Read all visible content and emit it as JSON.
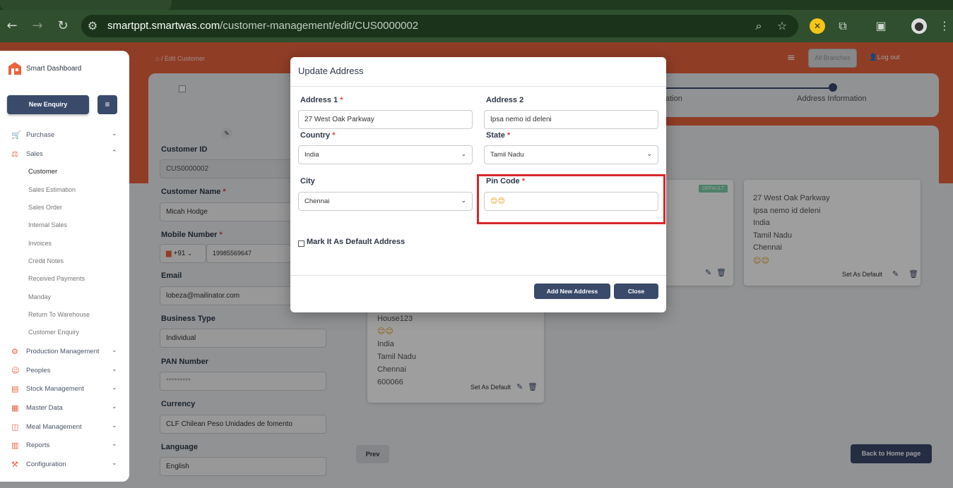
{
  "browser": {
    "url_host": "smartppt.smartwas.com",
    "url_path": "/customer-management/edit/CUS0000002"
  },
  "sidebar": {
    "brand": "Smart Dashboard",
    "new_enquiry": "New Enquiry",
    "items": [
      {
        "label": "Purchase",
        "icon": "cart-icon"
      },
      {
        "label": "Sales",
        "icon": "sales-icon"
      },
      {
        "label": "Production Management",
        "icon": "factory-icon"
      },
      {
        "label": "Peoples",
        "icon": "people-icon"
      },
      {
        "label": "Stock Management",
        "icon": "stock-icon"
      },
      {
        "label": "Master Data",
        "icon": "grid-icon"
      },
      {
        "label": "Meal Management",
        "icon": "meal-icon"
      },
      {
        "label": "Reports",
        "icon": "report-icon"
      },
      {
        "label": "Configuration",
        "icon": "config-icon"
      }
    ],
    "sales_sub": [
      "Customer",
      "Sales Estimation",
      "Sales Order",
      "Internal Sales",
      "Invoices",
      "Credit Notes",
      "Received Payments",
      "Manday",
      "Return To Warehouse",
      "Customer Enquiry"
    ]
  },
  "header": {
    "breadcrumb": "Edit Customer",
    "branch": "All Branches",
    "logout": "Log out"
  },
  "steps": {
    "step_partial": "ation",
    "step_last": "Address Information"
  },
  "form": {
    "customer_id_label": "Customer ID",
    "customer_id": "CUS0000002",
    "customer_name_label": "Customer Name",
    "customer_name": "Micah Hodge",
    "mobile_label": "Mobile Number",
    "country_code": "+91",
    "mobile": "19985569647",
    "email_label": "Email",
    "email": "lobeza@mailinator.com",
    "business_type_label": "Business Type",
    "business_type": "Individual",
    "pan_label": "PAN Number",
    "pan": "*********",
    "currency_label": "Currency",
    "currency": "CLF Chilean Peso Unidades de fomento",
    "language_label": "Language",
    "language": "English"
  },
  "address_cards": [
    {
      "lines": [
        "House123",
        "😊😊",
        "India",
        "Tamil Nadu",
        "Chennai",
        "600066"
      ],
      "set_default": "Set As Default"
    },
    {
      "badge": "DEFAULT"
    },
    {
      "lines": [
        "27 West Oak Parkway",
        "Ipsa nemo id deleni",
        "India",
        "Tamil Nadu",
        "Chennai",
        "😊😊"
      ],
      "set_default": "Set As Default"
    }
  ],
  "buttons": {
    "prev": "Prev",
    "back_home": "Back to Home page"
  },
  "modal": {
    "title": "Update Address",
    "address1_label": "Address 1",
    "address1": "27 West Oak Parkway",
    "address2_label": "Address 2",
    "address2": "Ipsa nemo id deleni",
    "country_label": "Country",
    "country": "India",
    "state_label": "State",
    "state": "Tamil Nadu",
    "city_label": "City",
    "city": "Chennai",
    "pincode_label": "Pin Code",
    "pincode": "😊😊",
    "default_label": "Mark It As Default Address",
    "add_button": "Add New Address",
    "close_button": "Close",
    "highlight_color": "#d8262a"
  }
}
